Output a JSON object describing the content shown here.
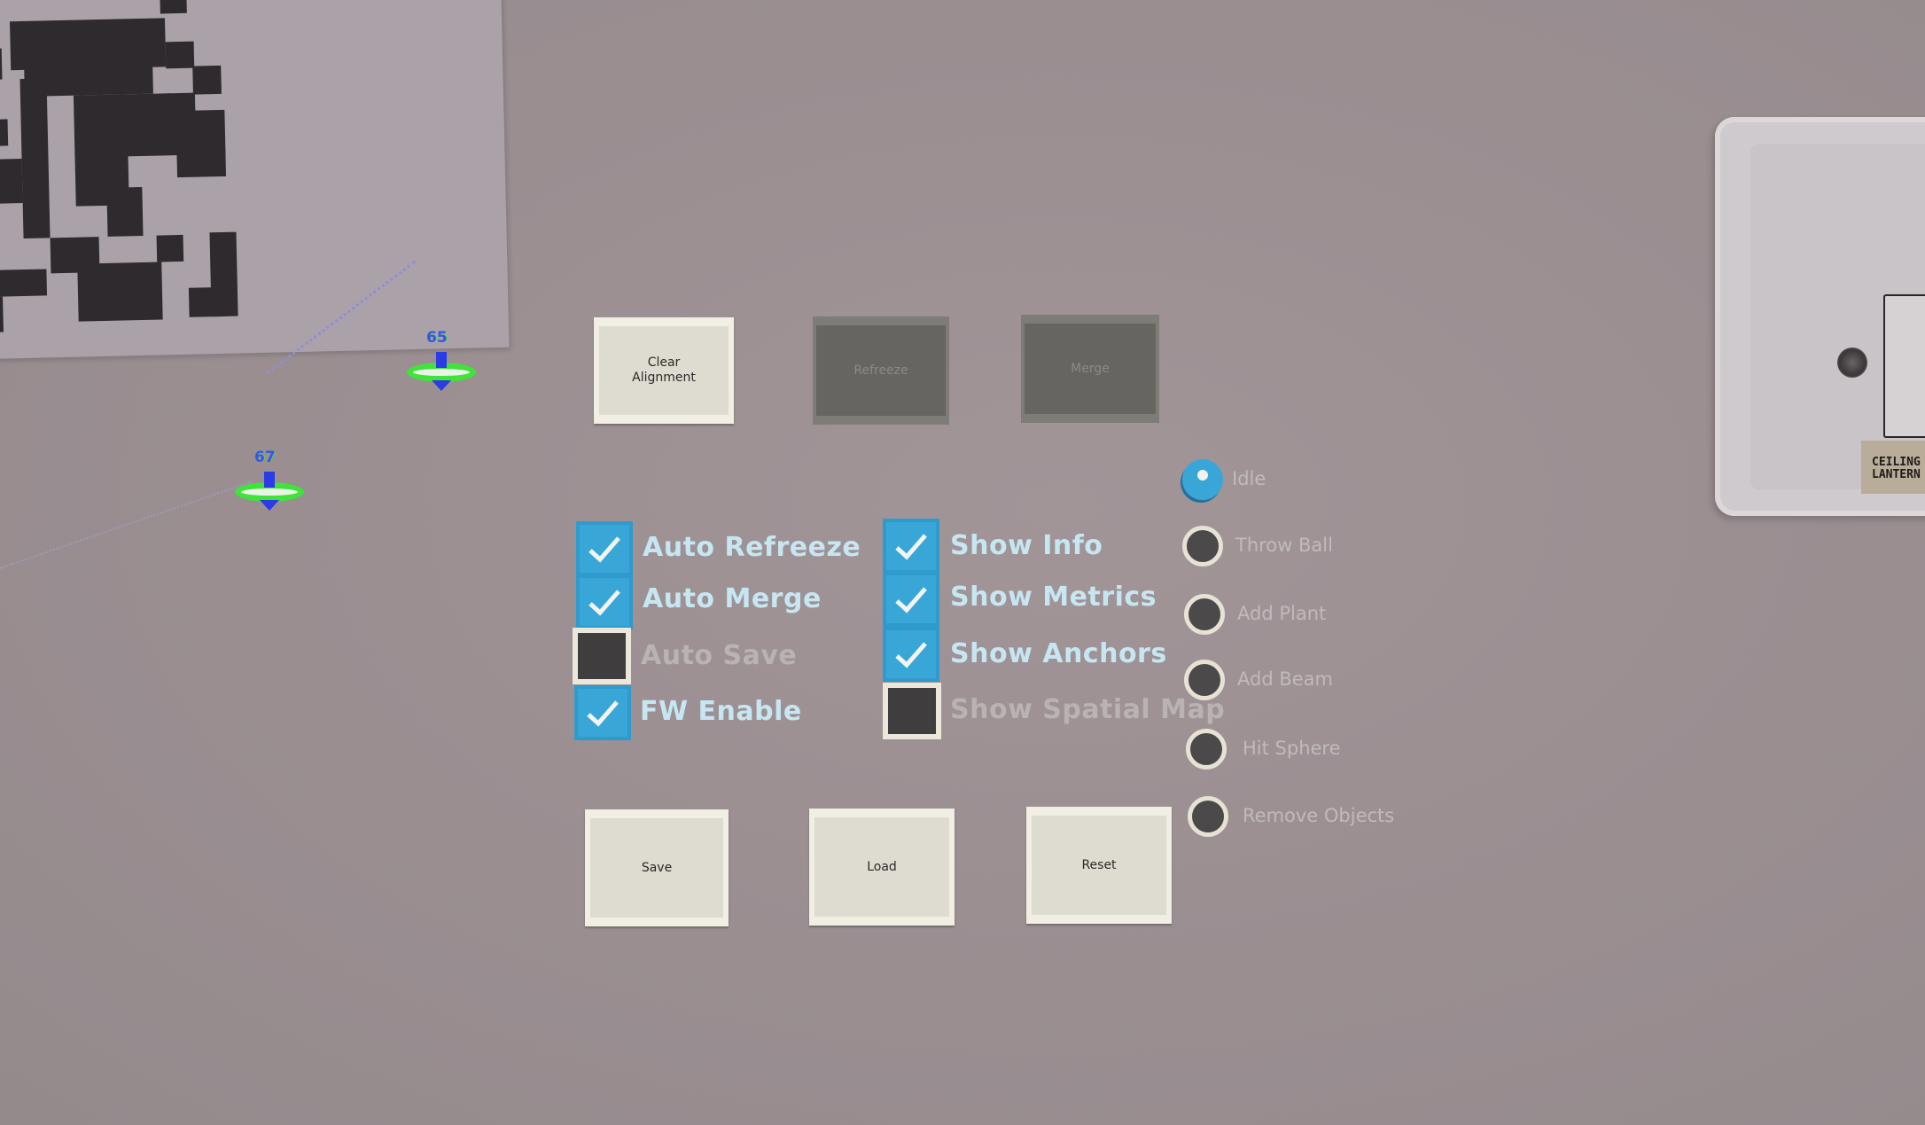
{
  "scene": {
    "background_color": "#9c9093",
    "accent_color": "#38a7d8"
  },
  "wall_switch": {
    "label_line1": "CEILING",
    "label_line2": "LANTERN"
  },
  "anchors": [
    {
      "label": "65"
    },
    {
      "label": "67"
    }
  ],
  "top_buttons": [
    {
      "label": "Clear Alignment",
      "enabled": true
    },
    {
      "label": "Refreeze",
      "enabled": false
    },
    {
      "label": "Merge",
      "enabled": false
    }
  ],
  "checkboxes_left": [
    {
      "label": "Auto Refreeze",
      "checked": true
    },
    {
      "label": "Auto Merge",
      "checked": true
    },
    {
      "label": "Auto Save",
      "checked": false
    },
    {
      "label": "FW Enable",
      "checked": true
    }
  ],
  "checkboxes_right": [
    {
      "label": "Show Info",
      "checked": true
    },
    {
      "label": "Show Metrics",
      "checked": true
    },
    {
      "label": "Show Anchors",
      "checked": true
    },
    {
      "label": "Show Spatial Map",
      "checked": false
    }
  ],
  "radio_group": {
    "selected": "Idle",
    "options": [
      {
        "label": "Idle",
        "selected": true
      },
      {
        "label": "Throw Ball",
        "selected": false
      },
      {
        "label": "Add Plant",
        "selected": false
      },
      {
        "label": "Add Beam",
        "selected": false
      },
      {
        "label": "Hit Sphere",
        "selected": false
      },
      {
        "label": "Remove Objects",
        "selected": false
      }
    ]
  },
  "bottom_buttons": [
    {
      "label": "Save"
    },
    {
      "label": "Load"
    },
    {
      "label": "Reset"
    }
  ]
}
